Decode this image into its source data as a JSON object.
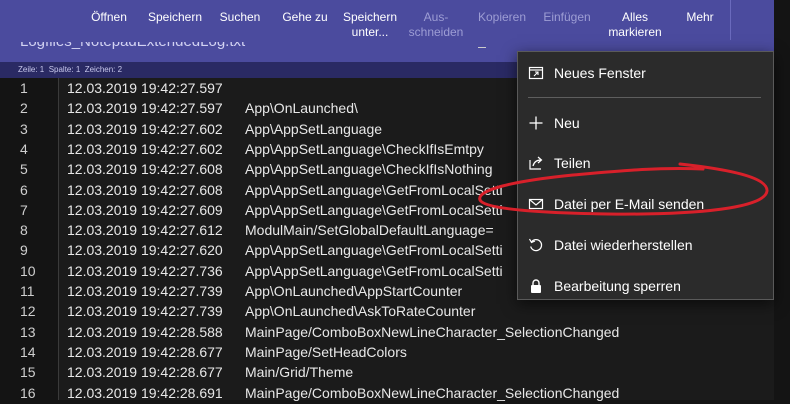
{
  "toolbar": {
    "items": [
      {
        "label": "Öffnen",
        "enabled": true
      },
      {
        "label": "Speichern",
        "enabled": true
      },
      {
        "label": "Suchen",
        "enabled": true
      },
      {
        "label": "Gehe zu",
        "enabled": true
      },
      {
        "label": "Speichern unter...",
        "enabled": true
      },
      {
        "label": "Aus- schneiden",
        "enabled": false
      },
      {
        "label": "Kopieren",
        "enabled": false
      },
      {
        "label": "Einfügen",
        "enabled": false
      },
      {
        "label": "Alles markieren",
        "enabled": true
      },
      {
        "label": "Mehr",
        "enabled": true
      }
    ]
  },
  "document": {
    "title": "Logfiles_NotepadExtendedLog.txt"
  },
  "status": {
    "line": "Zeile: 1",
    "column": "Spalte: 1",
    "chars": "Zeichen: 2"
  },
  "editor": {
    "lines": [
      {
        "n": "1",
        "ts": "12.03.2019 19:42:27.597",
        "msg": ""
      },
      {
        "n": "2",
        "ts": "12.03.2019 19:42:27.597",
        "msg": "App\\OnLaunched\\"
      },
      {
        "n": "3",
        "ts": "12.03.2019 19:42:27.602",
        "msg": "App\\AppSetLanguage"
      },
      {
        "n": "4",
        "ts": "12.03.2019 19:42:27.602",
        "msg": "App\\AppSetLanguage\\CheckIfIsEmtpy"
      },
      {
        "n": "5",
        "ts": "12.03.2019 19:42:27.608",
        "msg": "App\\AppSetLanguage\\CheckIfIsNothing"
      },
      {
        "n": "6",
        "ts": "12.03.2019 19:42:27.608",
        "msg": "App\\AppSetLanguage\\GetFromLocalSetti"
      },
      {
        "n": "7",
        "ts": "12.03.2019 19:42:27.609",
        "msg": "App\\AppSetLanguage\\GetFromLocalSetti"
      },
      {
        "n": "8",
        "ts": "12.03.2019 19:42:27.612",
        "msg": "ModulMain/SetGlobalDefaultLanguage="
      },
      {
        "n": "9",
        "ts": "12.03.2019 19:42:27.620",
        "msg": "App\\AppSetLanguage\\GetFromLocalSetti"
      },
      {
        "n": "10",
        "ts": "12.03.2019 19:42:27.736",
        "msg": "App\\AppSetLanguage\\GetFromLocalSetti"
      },
      {
        "n": "11",
        "ts": "12.03.2019 19:42:27.739",
        "msg": "App\\OnLaunched\\AppStartCounter"
      },
      {
        "n": "12",
        "ts": "12.03.2019 19:42:27.739",
        "msg": "App\\OnLaunched\\AskToRateCounter"
      },
      {
        "n": "13",
        "ts": "12.03.2019 19:42:28.588",
        "msg": "MainPage/ComboBoxNewLineCharacter_SelectionChanged"
      },
      {
        "n": "14",
        "ts": "12.03.2019 19:42:28.677",
        "msg": "MainPage/SetHeadColors"
      },
      {
        "n": "15",
        "ts": "12.03.2019 19:42:28.677",
        "msg": "Main/Grid/Theme"
      },
      {
        "n": "16",
        "ts": "12.03.2019 19:42:28.691",
        "msg": "MainPage/ComboBoxNewLineCharacter_SelectionChanged"
      }
    ]
  },
  "menu": {
    "items": [
      {
        "label": "Neues Fenster",
        "icon": "new-window-icon"
      },
      {
        "label": "Neu",
        "icon": "plus-icon"
      },
      {
        "label": "Teilen",
        "icon": "share-icon"
      },
      {
        "label": "Datei per E-Mail senden",
        "icon": "mail-icon"
      },
      {
        "label": "Datei wiederherstellen",
        "icon": "restore-icon"
      },
      {
        "label": "Bearbeitung sperren",
        "icon": "lock-icon"
      }
    ]
  },
  "colors": {
    "toolbar_bg": "#4b4b9e",
    "statusbar_bg": "#2a2a64",
    "editor_bg": "#1b1b1b",
    "menu_bg": "#2b2b2b",
    "annotation": "#d8202a"
  }
}
